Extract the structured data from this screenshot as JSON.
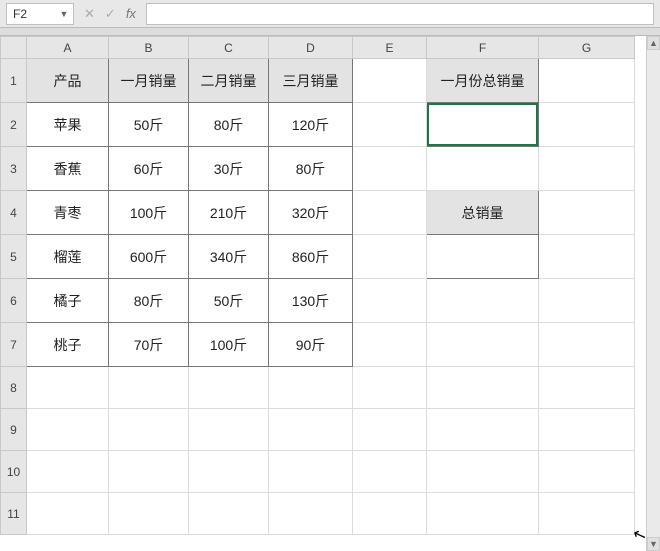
{
  "namebox": {
    "value": "F2"
  },
  "fb": {
    "cancel": "✕",
    "confirm": "✓",
    "fx": "fx"
  },
  "cols": {
    "A": "A",
    "B": "B",
    "C": "C",
    "D": "D",
    "E": "E",
    "F": "F",
    "G": "G"
  },
  "rows": {
    "r1": "1",
    "r2": "2",
    "r3": "3",
    "r4": "4",
    "r5": "5",
    "r6": "6",
    "r7": "7",
    "r8": "8",
    "r9": "9",
    "r10": "10",
    "r11": "11"
  },
  "table": {
    "headers": {
      "a": "产品",
      "b": "一月销量",
      "c": "二月销量",
      "d": "三月销量"
    },
    "rows": [
      {
        "a": "苹果",
        "b": "50斤",
        "c": "80斤",
        "d": "120斤"
      },
      {
        "a": "香蕉",
        "b": "60斤",
        "c": "30斤",
        "d": "80斤"
      },
      {
        "a": "青枣",
        "b": "100斤",
        "c": "210斤",
        "d": "320斤"
      },
      {
        "a": "榴莲",
        "b": "600斤",
        "c": "340斤",
        "d": "860斤"
      },
      {
        "a": "橘子",
        "b": "80斤",
        "c": "50斤",
        "d": "130斤"
      },
      {
        "a": "桃子",
        "b": "70斤",
        "c": "100斤",
        "d": "90斤"
      }
    ]
  },
  "side": {
    "f1": "一月份总销量",
    "f4": "总销量"
  },
  "colwidths": {
    "A": 82,
    "B": 80,
    "C": 80,
    "D": 84,
    "E": 74,
    "F": 112,
    "G": 96
  },
  "chart_data": {
    "type": "table",
    "title": "产品月销量",
    "columns": [
      "产品",
      "一月销量(斤)",
      "二月销量(斤)",
      "三月销量(斤)"
    ],
    "rows": [
      [
        "苹果",
        50,
        80,
        120
      ],
      [
        "香蕉",
        60,
        30,
        80
      ],
      [
        "青枣",
        100,
        210,
        320
      ],
      [
        "榴莲",
        600,
        340,
        860
      ],
      [
        "橘子",
        80,
        50,
        130
      ],
      [
        "桃子",
        70,
        100,
        90
      ]
    ],
    "side_labels": [
      "一月份总销量",
      "总销量"
    ]
  }
}
